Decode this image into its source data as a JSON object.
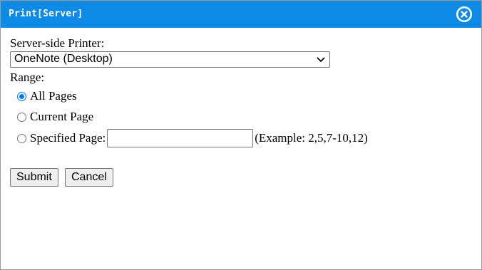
{
  "dialog": {
    "title": "Print[Server]",
    "close_icon": "close-circle-icon"
  },
  "form": {
    "printer_label": "Server-side Printer:",
    "printer_selected": "OneNote (Desktop)",
    "range_label": "Range:",
    "range_options": [
      {
        "label": "All Pages",
        "checked": true
      },
      {
        "label": "Current Page",
        "checked": false
      },
      {
        "label": "Specified Page:",
        "checked": false
      }
    ],
    "specified_value": "",
    "example_text": "(Example: 2,5,7-10,12)",
    "submit_label": "Submit",
    "cancel_label": "Cancel"
  },
  "colors": {
    "titlebar": "#0d89e6",
    "radio_accent": "#0075ff"
  }
}
